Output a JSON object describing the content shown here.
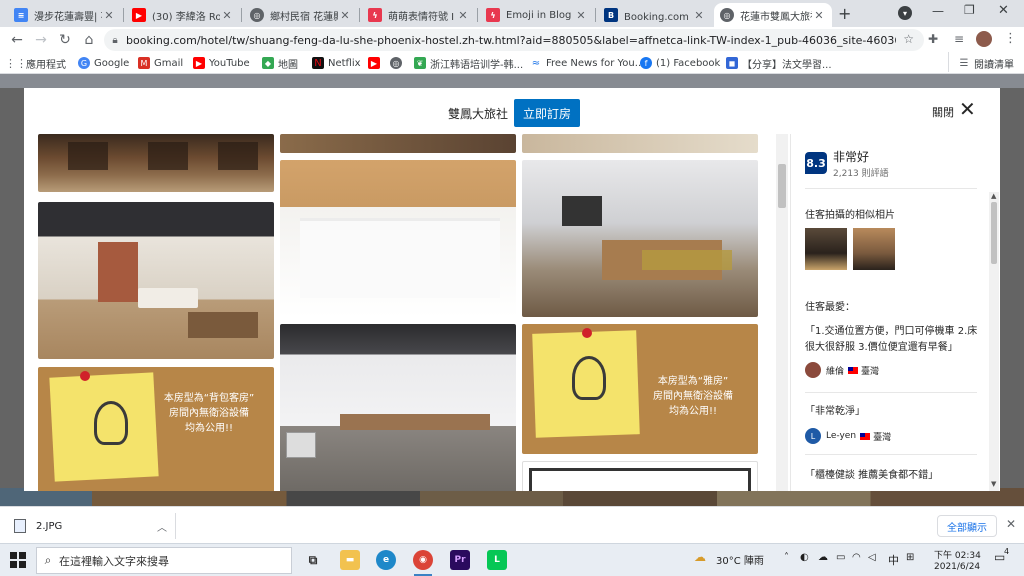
{
  "tabs": [
    {
      "title": "漫步花蓮壽豐| 花",
      "favicon": "docs-icon",
      "color": "#4285f4"
    },
    {
      "title": "(30) 李緯洛 Rong",
      "favicon": "youtube-icon",
      "color": "#ff0000"
    },
    {
      "title": "鄉村民宿 花蓮縣",
      "favicon": "globe-icon",
      "color": "#5f6368"
    },
    {
      "title": "萌萌表情符號 I",
      "favicon": "lightning-icon",
      "color": "#e8384f"
    },
    {
      "title": "Emoji in Blog",
      "favicon": "lightning-icon",
      "color": "#e8384f"
    },
    {
      "title": "Booking.com : 斜",
      "favicon": "booking-icon",
      "color": "#003580"
    },
    {
      "title": "花蓮市雙鳳大旅社",
      "favicon": "globe-icon",
      "color": "#5f6368",
      "active": true
    }
  ],
  "toolbar": {
    "url": "booking.com/hotel/tw/shuang-feng-da-lu-she-phoenix-hostel.zh-tw.html?aid=880505&label=affnetca-link-TW-index-1_pub-46036_site-46036_pnam..."
  },
  "bookmarks": [
    {
      "label": "應用程式",
      "icon": "apps-grid-icon",
      "color": "#5f6368"
    },
    {
      "label": "Google",
      "icon": "google-icon",
      "color": "#4285f4"
    },
    {
      "label": "Gmail",
      "icon": "gmail-icon",
      "color": "#d93025"
    },
    {
      "label": "YouTube",
      "icon": "youtube-icon",
      "color": "#ff0000"
    },
    {
      "label": "地圖",
      "icon": "maps-icon",
      "color": "#34a853"
    },
    {
      "label": "Netflix",
      "icon": "netflix-icon",
      "color": "#e50914"
    },
    {
      "label": "",
      "icon": "youtube-icon",
      "color": "#ff0000"
    },
    {
      "label": "",
      "icon": "globe-icon",
      "color": "#5f6368"
    },
    {
      "label": "浙江韩语培训学-韩...",
      "icon": "leaf-icon",
      "color": "#34a853"
    },
    {
      "label": "Free News for You...",
      "icon": "news-icon",
      "color": "#1a73e8"
    },
    {
      "label": "(1) Facebook",
      "icon": "facebook-icon",
      "color": "#1877f2"
    },
    {
      "label": "【分享】法文學習...",
      "icon": "bookmark-icon",
      "color": "#3367d6"
    }
  ],
  "reading_list": "閱讀清單",
  "modal": {
    "hotel_name": "雙鳳大旅社",
    "book_button": "立即訂房",
    "close_label": "關閉"
  },
  "photos": {
    "note_left": "本房型為“背包客房”\n房間內無衛浴設備\n均為公用!!",
    "note_right": "本房型為“雅房”\n房間內無衛浴設備\n均為公用!!"
  },
  "panel": {
    "score": "8.3",
    "rating_word": "非常好",
    "review_count": "2,213 則評語",
    "similar_photos_title": "住客拍攝的相似相片",
    "favorite_title": "住客最愛：",
    "reviews": [
      {
        "text": "「1.交通位置方便，門口可停機車 2.床很大很舒服 3.價位便宜還有早餐」",
        "name": "維倫",
        "country": "臺灣",
        "avatar_color": "#8b4a3c",
        "avatar_letter": ""
      },
      {
        "text": "「非常乾淨」",
        "name": "Le-yen",
        "country": "臺灣",
        "avatar_color": "#1f5aa6",
        "avatar_letter": "L"
      },
      {
        "text": "「櫃檯健談 推薦美食都不錯」",
        "name": "",
        "country": "",
        "avatar_color": "",
        "avatar_letter": ""
      }
    ]
  },
  "download": {
    "filename": "2.JPG",
    "show_all": "全部顯示"
  },
  "taskbar": {
    "search_placeholder": "在這裡輸入文字來搜尋",
    "weather": "30°C 陣雨",
    "ime": "中",
    "time": "下午 02:34",
    "date": "2021/6/24",
    "notifications": "4"
  }
}
